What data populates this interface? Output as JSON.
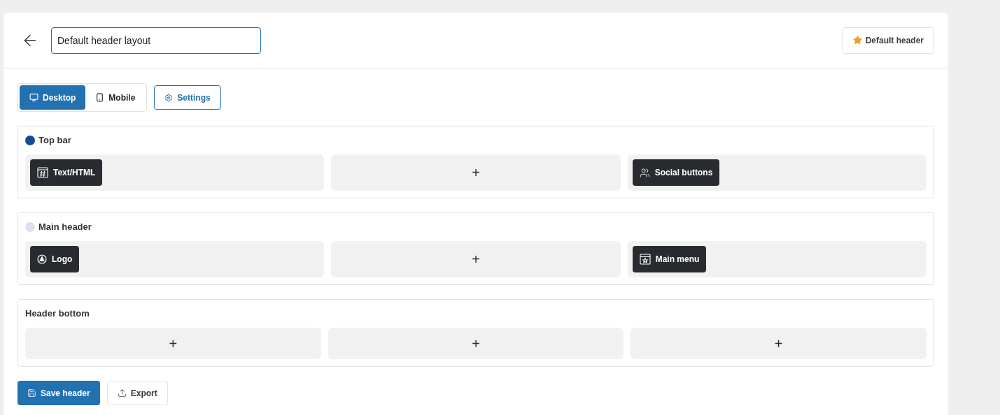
{
  "header": {
    "title_value": "Default header layout",
    "default_button": "Default header"
  },
  "view_tabs": [
    {
      "label": "Desktop",
      "selected": true
    },
    {
      "label": "Mobile",
      "selected": false
    }
  ],
  "settings_button": "Settings",
  "rows": [
    {
      "label": "Top bar",
      "color": "#164a96",
      "cells": [
        {
          "kind": "block",
          "label": "Text/HTML"
        },
        {
          "kind": "add",
          "label": "+"
        },
        {
          "kind": "block",
          "label": "Social buttons"
        }
      ]
    },
    {
      "label": "Main header",
      "color": "#dce2ec",
      "cells": [
        {
          "kind": "block",
          "label": "Logo"
        },
        {
          "kind": "add",
          "label": "+"
        },
        {
          "kind": "block",
          "label": "Main menu"
        }
      ]
    },
    {
      "label": "Header bottom",
      "cells": [
        {
          "kind": "add",
          "label": "+"
        },
        {
          "kind": "add",
          "label": "+"
        },
        {
          "kind": "add",
          "label": "+"
        }
      ]
    }
  ],
  "actions": {
    "save": "Save header",
    "export": "Export"
  }
}
